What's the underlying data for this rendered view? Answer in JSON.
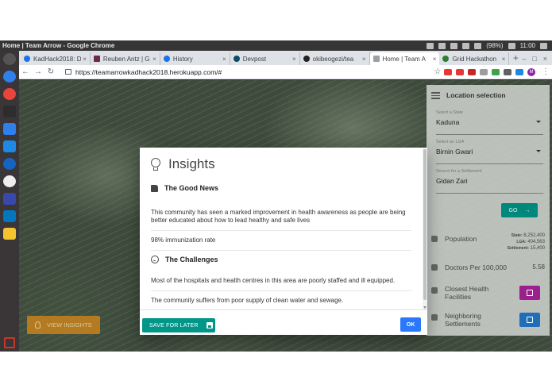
{
  "os": {
    "window_title": "Home | Team Arrow - Google Chrome",
    "battery": "(98%)",
    "clock": "11:00"
  },
  "browser": {
    "tabs": [
      {
        "label": "KadHack2018: D",
        "color": "#1a73e8"
      },
      {
        "label": "Reuben Antz | G",
        "color": "#6d2b4a"
      },
      {
        "label": "History",
        "color": "#1a73e8"
      },
      {
        "label": "Devpost",
        "color": "#0b4d61"
      },
      {
        "label": "okibeogezi/tea",
        "color": "#222222"
      },
      {
        "label": "Home | Team A",
        "color": "#5f6368"
      },
      {
        "label": "Grid Hackathon",
        "color": "#2e7d32"
      }
    ],
    "active_tab": 5,
    "url": "https://teamarrowkadhack2018.herokuapp.com/#"
  },
  "location_panel": {
    "title": "Location selection",
    "state_label": "Select a State",
    "state_value": "Kaduna",
    "lga_label": "Select an LGA",
    "lga_value": "Birnin Gwari",
    "settlement_label": "Search for a Settlement",
    "settlement_value": "Gidan Zari",
    "go_label": "GO",
    "population_label": "Population",
    "population_state_key": "State:",
    "population_state_value": "8,252,400",
    "population_lga_key": "LGA:",
    "population_lga_value": "404,563",
    "population_settlement_key": "Settlement:",
    "population_settlement_value": "15,400",
    "doctors_label": "Doctors Per 100,000",
    "doctors_value": "5.58",
    "health_label_1": "Closest Health",
    "health_label_2": "Facilities",
    "neighbor_label_1": "Neighboring",
    "neighbor_label_2": "Settlements",
    "colors": {
      "health_button": "#9c1f8e",
      "neighbor_button": "#1f6fb8",
      "go_button": "#00897b"
    }
  },
  "view_insights_label": "VIEW INSIGHTS",
  "modal": {
    "title": "Insights",
    "good_news_heading": "The Good News",
    "good_news_items": [
      "This community has seen a marked improvement in health awareness as people are being better educated about how to lead healthy and safe lives",
      "98% immunization rate"
    ],
    "challenges_heading": "The Challenges",
    "challenges_items": [
      "Most of the hospitals and health centres in this area are poorly staffed and ill equipped.",
      "The community suffers from poor supply of clean water and sewage."
    ],
    "save_label": "SAVE FOR LATER",
    "ok_label": "OK"
  }
}
